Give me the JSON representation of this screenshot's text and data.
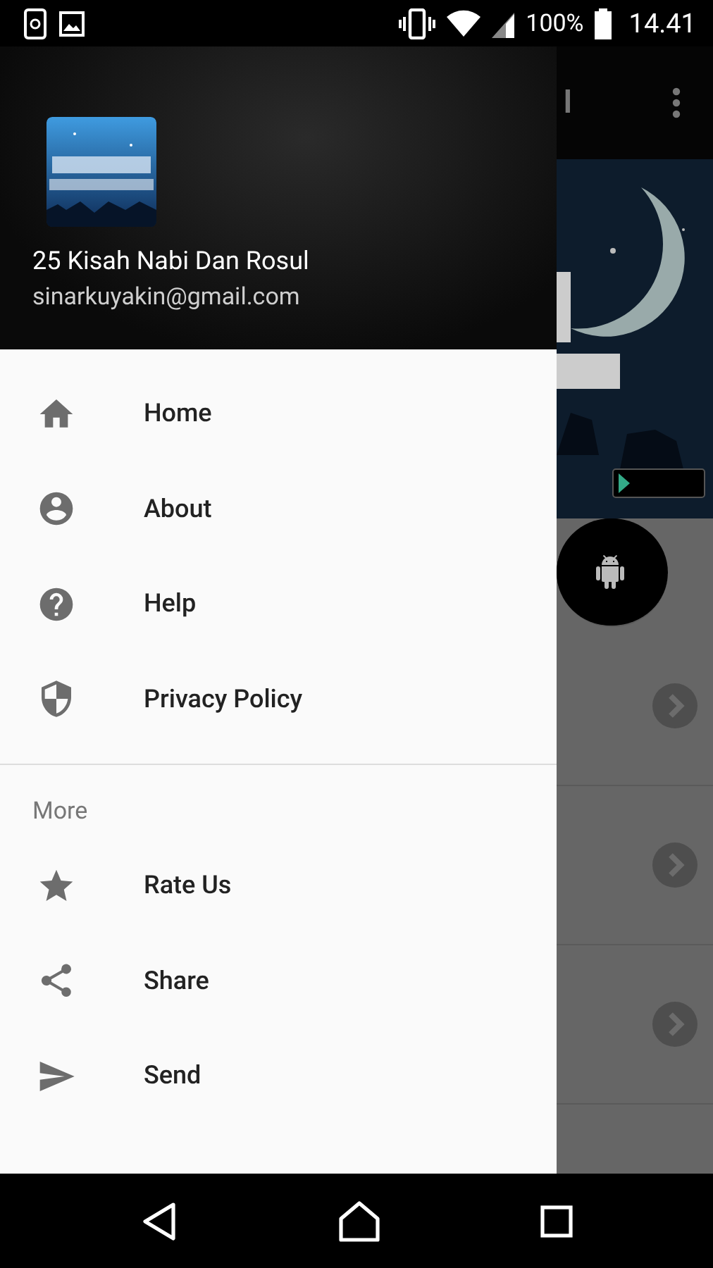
{
  "status_bar": {
    "battery": "100%",
    "time": "14.41"
  },
  "drawer": {
    "header": {
      "title": "25 Kisah Nabi Dan Rosul",
      "email": "sinarkuyakin@gmail.com"
    },
    "sections": [
      {
        "items": [
          {
            "label": "Home",
            "kind": "home"
          },
          {
            "label": "About",
            "kind": "account"
          },
          {
            "label": "Help",
            "kind": "help"
          },
          {
            "label": "Privacy Policy",
            "kind": "shield"
          }
        ]
      },
      {
        "title": "More",
        "items": [
          {
            "label": "Rate Us",
            "kind": "star"
          },
          {
            "label": "Share",
            "kind": "share"
          },
          {
            "label": "Send",
            "kind": "send"
          }
        ]
      }
    ]
  },
  "background_app": {
    "title": "l",
    "rows": [
      {
        "kind": "fab"
      },
      {
        "kind": "chevron"
      },
      {
        "kind": "chevron"
      },
      {
        "kind": "chevron"
      }
    ]
  }
}
